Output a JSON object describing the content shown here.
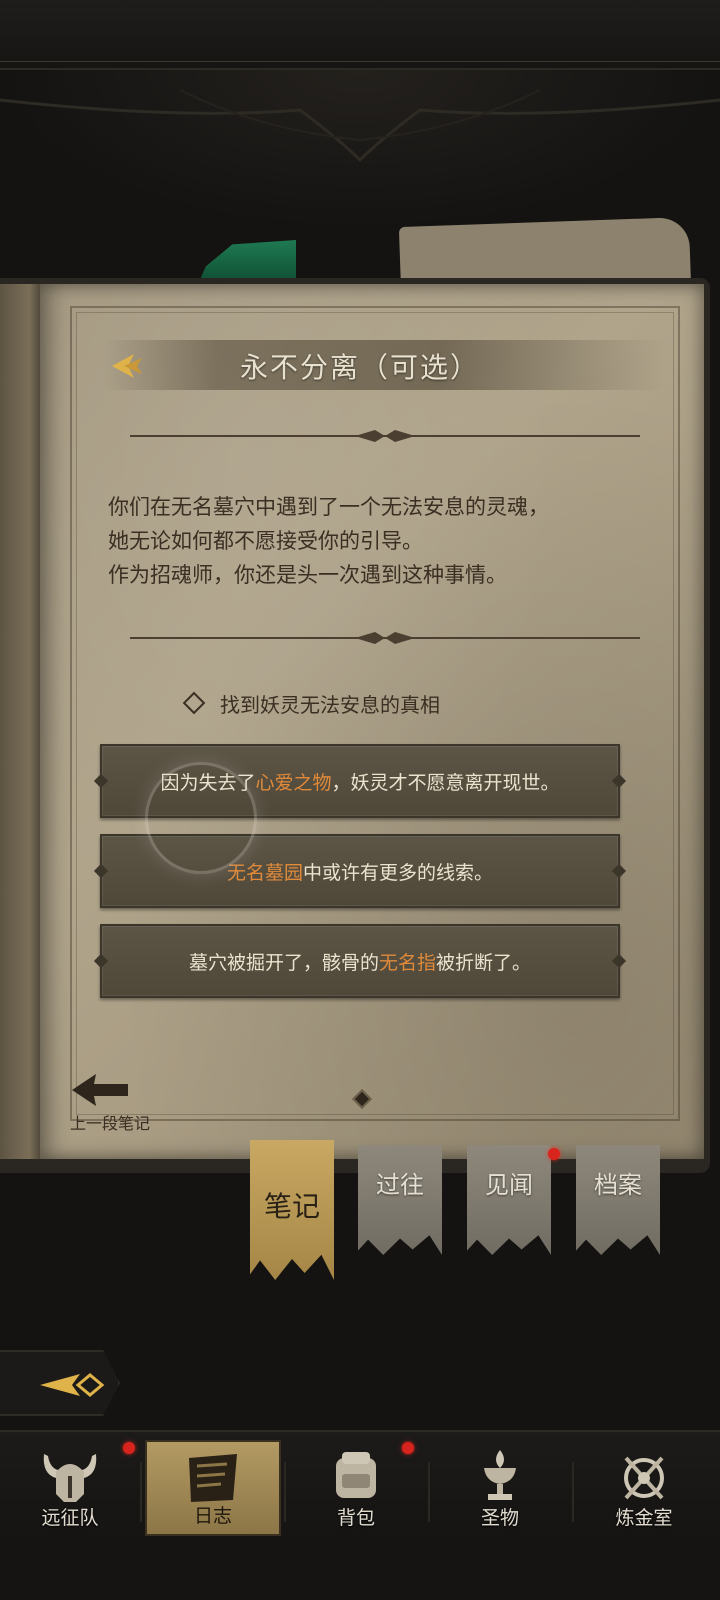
{
  "quest": {
    "title": "永不分离（可选）",
    "story_lines": [
      "你们在无名墓穴中遇到了一个无法安息的灵魂，",
      "她无论如何都不愿接受你的引导。",
      "作为招魂师，你还是头一次遇到这种事情。"
    ],
    "objective": "找到妖灵无法安息的真相"
  },
  "clues": [
    {
      "before": "因为失去了",
      "highlight": "心爱之物",
      "after": "，妖灵才不愿意离开现世。"
    },
    {
      "before": "",
      "highlight": "无名墓园",
      "after": "中或许有更多的线索。"
    },
    {
      "before": "墓穴被掘开了，骸骨的",
      "highlight": "无名指",
      "after": "被折断了。"
    }
  ],
  "prev_note_label": "上一段笔记",
  "tabs": [
    {
      "label": "笔记",
      "active": true
    },
    {
      "label": "过往",
      "active": false
    },
    {
      "label": "见闻",
      "active": false,
      "badge": true
    },
    {
      "label": "档案",
      "active": false
    }
  ],
  "bottom_nav": [
    {
      "label": "远征队",
      "icon": "horned-helmet-icon",
      "badge": true
    },
    {
      "label": "日志",
      "icon": "journal-icon",
      "active": true
    },
    {
      "label": "背包",
      "icon": "backpack-icon",
      "badge": true
    },
    {
      "label": "圣物",
      "icon": "relic-chalice-icon"
    },
    {
      "label": "炼金室",
      "icon": "alchemy-icon"
    }
  ],
  "colors": {
    "highlight": "#e08a3a",
    "clue_text": "#ece3cf",
    "ink": "#3a2f22",
    "active_tab": "#c8a862",
    "badge_red": "#d8241c"
  }
}
